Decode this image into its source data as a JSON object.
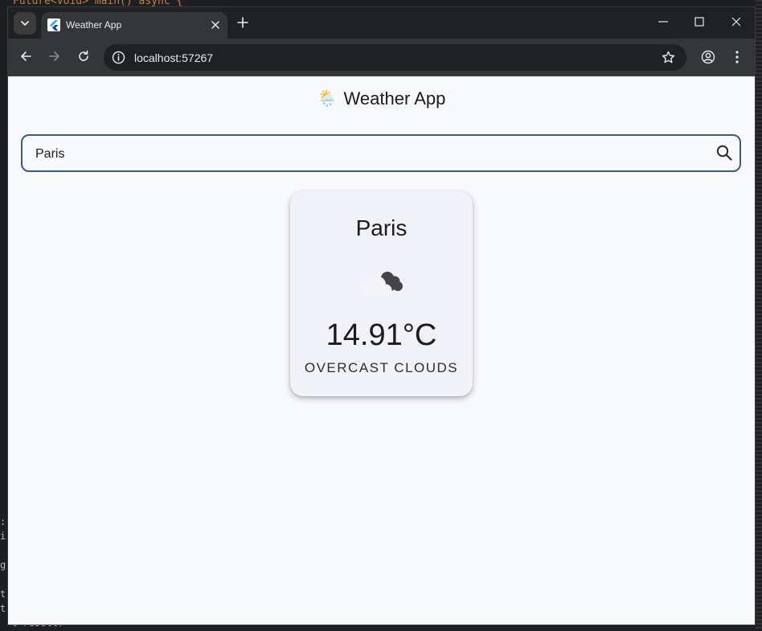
{
  "browser": {
    "tab_title": "Weather App",
    "url": "localhost:57267"
  },
  "app": {
    "icon": "🌦️",
    "title": "Weather App"
  },
  "search": {
    "value": "Paris",
    "placeholder": ""
  },
  "weather": {
    "city": "Paris",
    "temperature": "14.91°C",
    "description": "OVERCAST CLOUDS",
    "icon": "overcast-clouds-icon"
  },
  "background": {
    "code_top": "Future<void> main() async {",
    "code_bottom": "t result."
  },
  "colors": {
    "page_bg": "#f8f9fd",
    "card_bg": "#f1f2f8",
    "search_border": "#3d5a78",
    "text": "#1b1b1f"
  }
}
